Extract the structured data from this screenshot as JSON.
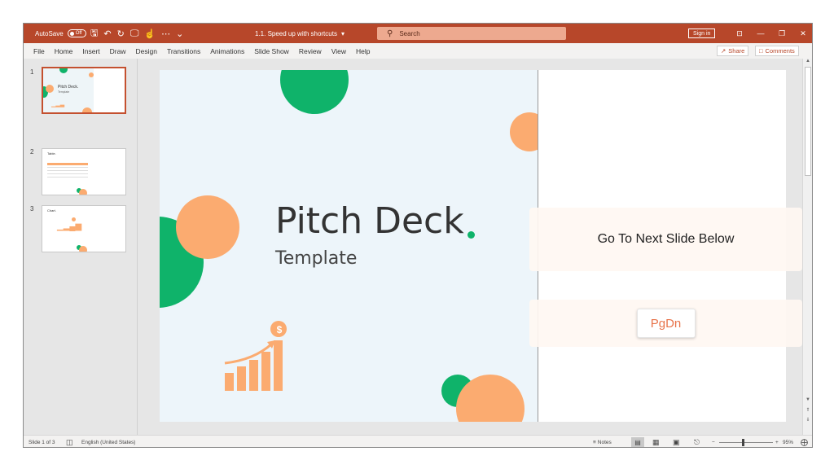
{
  "titlebar": {
    "autosave_label": "AutoSave",
    "autosave_state": "Off",
    "doc_title": "1.1. Speed up with shortcuts",
    "doc_title_caret": "▾",
    "search_placeholder": "Search",
    "signin_label": "Sign in",
    "ribbon_display_icon": "⊡",
    "minimize_icon": "—",
    "restore_icon": "❐",
    "close_icon": "✕",
    "qat": {
      "save": "🖫",
      "undo": "↶",
      "redo": "↻",
      "present": "🖵",
      "touch": "☝",
      "more": "⋯",
      "customize": "⌄"
    }
  },
  "menu": {
    "tabs": [
      "File",
      "Home",
      "Insert",
      "Draw",
      "Design",
      "Transitions",
      "Animations",
      "Slide Show",
      "Review",
      "View",
      "Help"
    ],
    "share_label": "Share",
    "comments_label": "Comments"
  },
  "thumbnails": [
    {
      "number": "1",
      "title": "Pitch Deck.",
      "subtitle": "Template",
      "active": true
    },
    {
      "number": "2",
      "title": "Table.",
      "active": false
    },
    {
      "number": "3",
      "title": "Chart.",
      "active": false
    }
  ],
  "slide": {
    "title": "Pitch Deck",
    "subtitle": "Template",
    "coin_symbol": "$"
  },
  "callouts": {
    "next_slide": "Go To Next Slide Below",
    "key": "PgDn"
  },
  "status": {
    "slide_counter": "Slide 1 of 3",
    "language": "English (United States)",
    "notes_label": "Notes",
    "zoom_minus": "−",
    "zoom_plus": "+",
    "zoom_level": "95%"
  },
  "colors": {
    "brand": "#b7472a",
    "green": "#0fb36a",
    "orange": "#fbab70"
  }
}
